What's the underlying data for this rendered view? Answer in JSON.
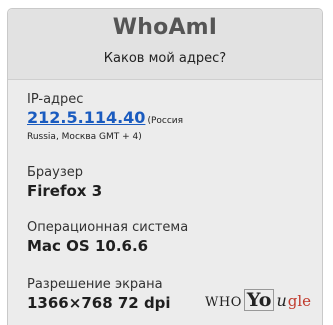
{
  "header": {
    "title": "WhoAmI",
    "subtitle": "Каков мой адрес?"
  },
  "ip": {
    "label": "IP-адрес",
    "address": "212.5.114.40",
    "note_line1": "(Россия",
    "note_line2": "Russia, Москва GMT + 4)"
  },
  "browser": {
    "label": "Браузер",
    "value": "Firefox 3"
  },
  "os": {
    "label": "Операционная система",
    "value": "Mac OS 10.6.6"
  },
  "resolution": {
    "label": "Разрешение экрана",
    "value": "1366×768 72 dpi"
  },
  "logo": {
    "who": "WHO",
    "yo": "Yo",
    "u": "u",
    "gle": "gle"
  },
  "colors": {
    "link": "#1a5bbf",
    "panel": "#ececec",
    "header": "#e2e2e2"
  }
}
